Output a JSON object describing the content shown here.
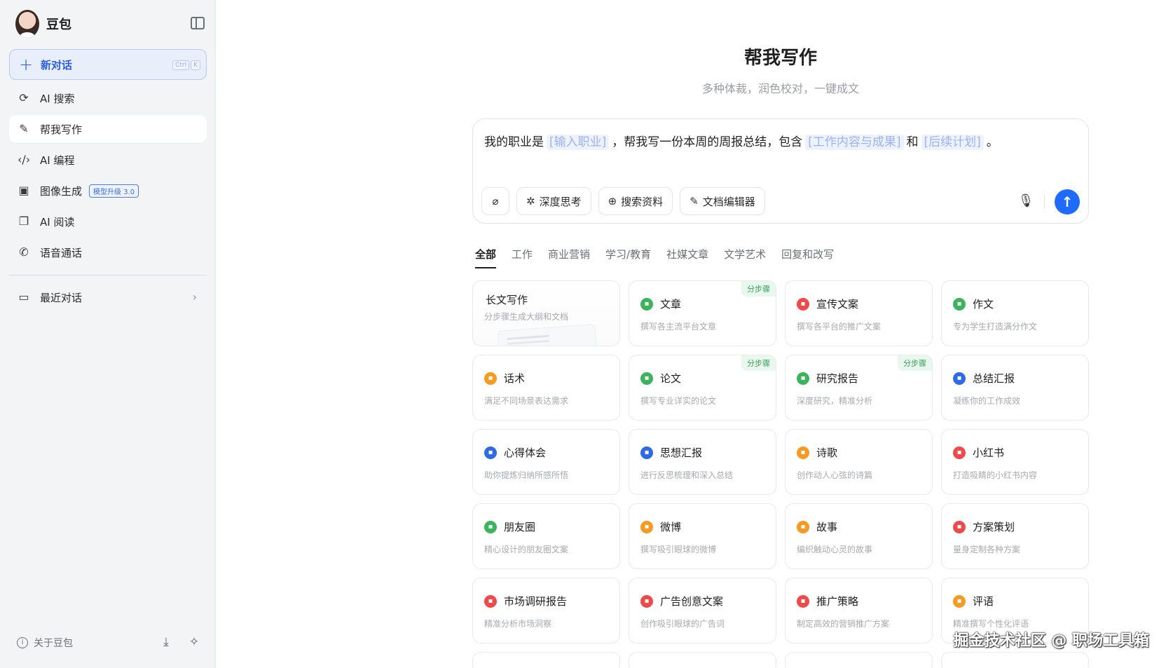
{
  "sidebar": {
    "brand": "豆包",
    "new_chat": {
      "label": "新对话",
      "kbd": [
        "Ctrl",
        "K"
      ]
    },
    "items": [
      {
        "label": "AI 搜索",
        "icon": "search-icon",
        "glyph": "⟳"
      },
      {
        "label": "帮我写作",
        "icon": "pen-icon",
        "glyph": "✎",
        "active": true
      },
      {
        "label": "AI 编程",
        "icon": "code-icon",
        "glyph": "‹/›"
      },
      {
        "label": "图像生成",
        "icon": "image-icon",
        "glyph": "▣",
        "badge": "模型升级 3.0"
      },
      {
        "label": "AI 阅读",
        "icon": "book-icon",
        "glyph": "❐"
      },
      {
        "label": "语音通话",
        "icon": "phone-icon",
        "glyph": "✆"
      }
    ],
    "recent": "最近对话",
    "about": "关于豆包"
  },
  "main": {
    "title": "帮我写作",
    "subtitle": "多种体裁，润色校对，一键成文",
    "prompt": {
      "p1": "我的职业是",
      "s1": "[输入职业]",
      "p2": "，帮我写一份本周的周报总结，包含",
      "s2": "[工作内容与成果]",
      "p3": "和",
      "s3": "[后续计划]",
      "p4": "。"
    },
    "tools": {
      "deep": "深度思考",
      "search": "搜索资料",
      "editor": "文档编辑器"
    },
    "tabs": [
      "全部",
      "工作",
      "商业营销",
      "学习/教育",
      "社媒文章",
      "文学艺术",
      "回复和改写"
    ],
    "cards": [
      {
        "title": "长文写作",
        "desc": "分步骤生成大纲和文档",
        "long": true
      },
      {
        "title": "文章",
        "desc": "撰写各主流平台文章",
        "color": "#3cb35c",
        "tag": "分步骤"
      },
      {
        "title": "宣传文案",
        "desc": "撰写各平台的推广文案",
        "color": "#ef4a4a"
      },
      {
        "title": "作文",
        "desc": "专为学生打造满分作文",
        "color": "#3cb35c"
      },
      {
        "title": "话术",
        "desc": "满足不同场景表达需求",
        "color": "#f59a23"
      },
      {
        "title": "论文",
        "desc": "撰写专业详实的论文",
        "color": "#3cb35c",
        "tag": "分步骤"
      },
      {
        "title": "研究报告",
        "desc": "深度研究，精准分析",
        "color": "#3cb35c",
        "tag": "分步骤"
      },
      {
        "title": "总结汇报",
        "desc": "凝练你的工作成效",
        "color": "#2f6ae6"
      },
      {
        "title": "心得体会",
        "desc": "助你提炼归纳所感所悟",
        "color": "#2f6ae6"
      },
      {
        "title": "思想汇报",
        "desc": "进行反思梳理和深入总结",
        "color": "#2f6ae6"
      },
      {
        "title": "诗歌",
        "desc": "创作动人心弦的诗篇",
        "color": "#f59a23"
      },
      {
        "title": "小红书",
        "desc": "打造吸睛的小红书内容",
        "color": "#ef4a4a"
      },
      {
        "title": "朋友圈",
        "desc": "精心设计的朋友圈文案",
        "color": "#3cb35c"
      },
      {
        "title": "微博",
        "desc": "撰写吸引眼球的微博",
        "color": "#f59a23"
      },
      {
        "title": "故事",
        "desc": "编织触动心灵的故事",
        "color": "#f59a23"
      },
      {
        "title": "方案策划",
        "desc": "量身定制各种方案",
        "color": "#ef4a4a"
      },
      {
        "title": "市场调研报告",
        "desc": "精准分析市场洞察",
        "color": "#ef4a4a"
      },
      {
        "title": "广告创意文案",
        "desc": "创作吸引眼球的广告词",
        "color": "#ef4a4a"
      },
      {
        "title": "推广策略",
        "desc": "制定高效的营销推广方案",
        "color": "#ef4a4a"
      },
      {
        "title": "评语",
        "desc": "精准撰写个性化评语",
        "color": "#f59a23"
      }
    ]
  },
  "watermark": "掘金技术社区 @ 职场工具箱"
}
